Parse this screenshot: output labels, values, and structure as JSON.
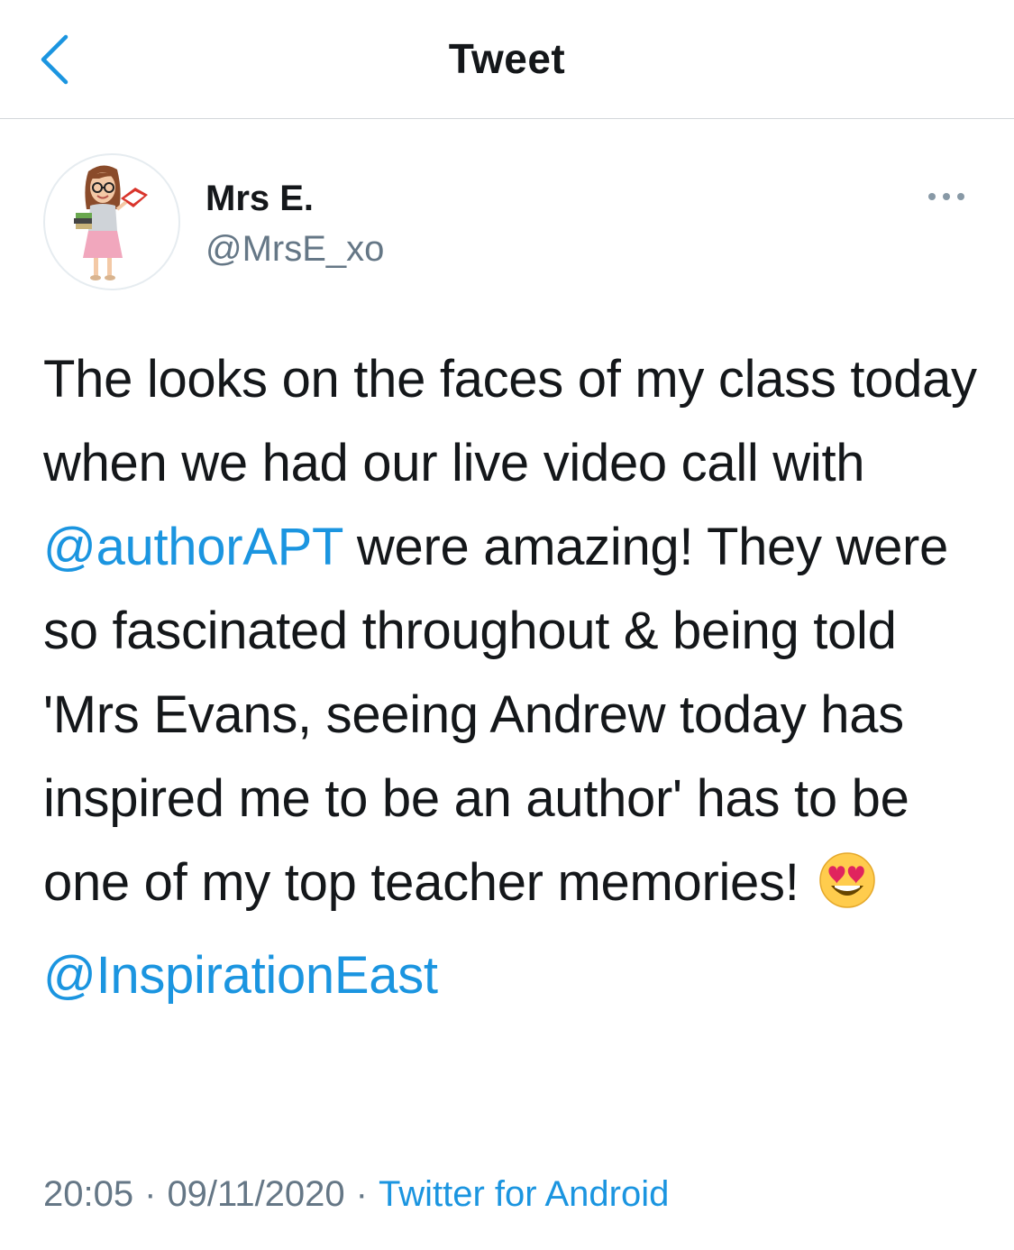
{
  "header": {
    "title": "Tweet",
    "back_icon": "chevron-left-icon"
  },
  "colors": {
    "accent": "#1b95e0",
    "text": "#14171a",
    "secondary": "#657786",
    "divider": "#d3d7da"
  },
  "tweet": {
    "author": {
      "display_name": "Mrs E.",
      "handle": "@MrsE_xo",
      "avatar_icon": "teacher-bitmoji-avatar"
    },
    "more_icon": "more-horizontal-icon",
    "text": {
      "part1": "The looks on the faces of my class today when we had our live video call with ",
      "mention1": "@authorAPT",
      "part2": " were amazing! They were so fascinated throughout & being told 'Mrs Evans, seeing Andrew today has inspired me to be an author' has to be one of my top teacher memories! ",
      "emoji": "smiling-face-with-heart-eyes",
      "mention2": "@InspirationEast"
    },
    "time": "20:05",
    "date": "09/11/2020",
    "separator": "·",
    "source": "Twitter for Android"
  }
}
